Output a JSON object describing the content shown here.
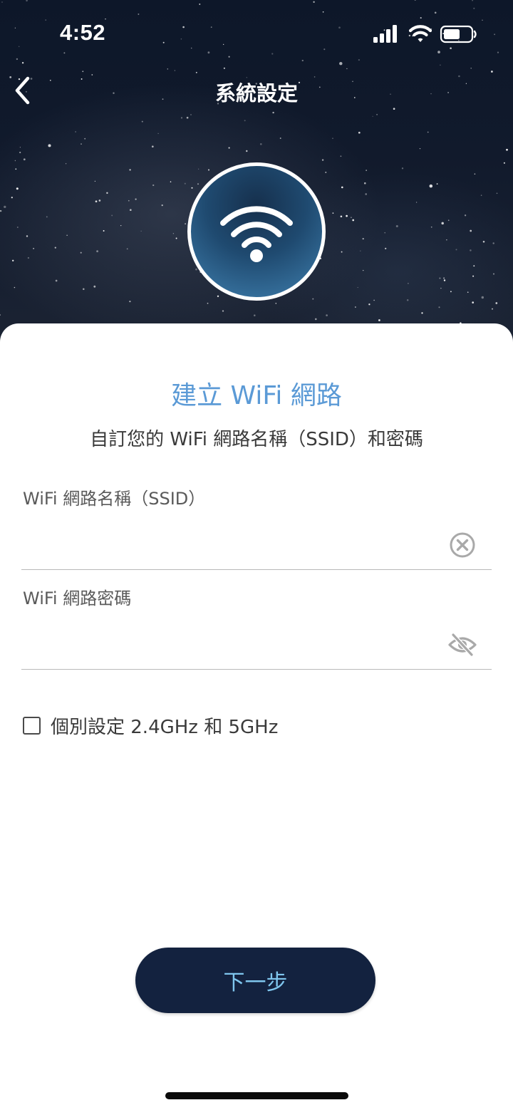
{
  "status_bar": {
    "time": "4:52",
    "icons": [
      "cellular-signal-icon",
      "wifi-signal-icon",
      "battery-icon"
    ],
    "battery_level": 0.6
  },
  "nav": {
    "title": "系統設定",
    "back_icon": "chevron-left-icon"
  },
  "hero": {
    "icon": "wifi-icon",
    "badge_border_color": "#ffffff"
  },
  "sheet": {
    "title": "建立 WiFi 網路",
    "subtitle": "自訂您的 WiFi 網路名稱（SSID）和密碼",
    "title_color": "#5b9ad6"
  },
  "ssid_field": {
    "label": "WiFi 網路名稱（SSID）",
    "value": "",
    "icon": "clear-circle-icon"
  },
  "password_field": {
    "label": "WiFi 網路密碼",
    "value": "",
    "icon": "eye-slash-icon"
  },
  "separate_bands": {
    "label": "個別設定 2.4GHz 和 5GHz",
    "checked": false
  },
  "next_button": {
    "label": "下一步",
    "background": "#13223f",
    "text_color": "#7fc6ee"
  }
}
